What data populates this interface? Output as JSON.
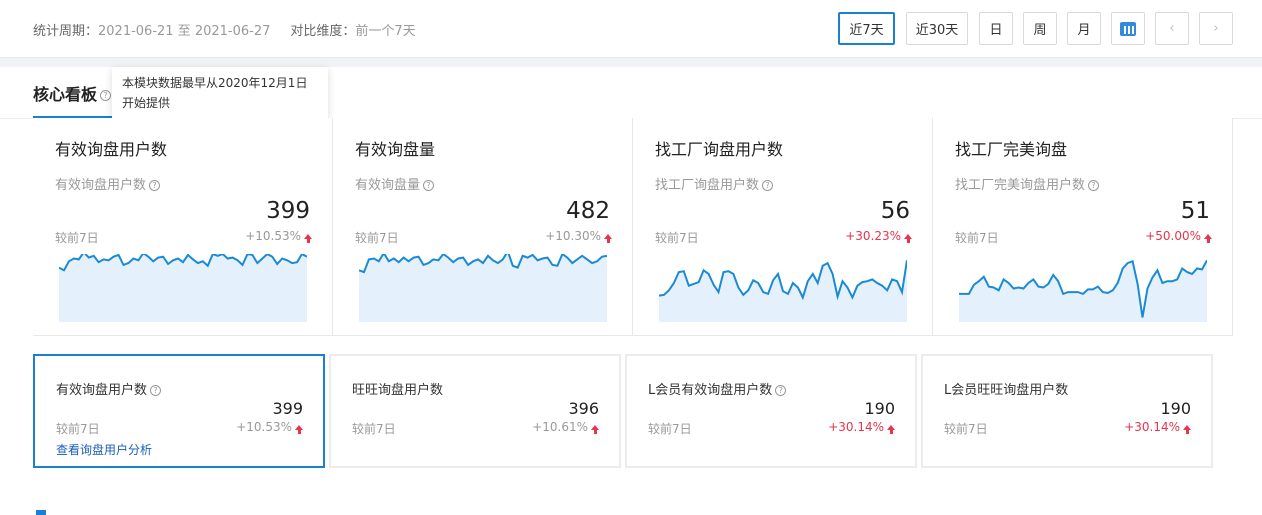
{
  "filter": {
    "period_label": "统计周期：",
    "period_value": "2021-06-21 至 2021-06-27",
    "compare_label": "对比维度：",
    "compare_value": "前一个7天",
    "buttons": [
      "近7天",
      "近30天",
      "日",
      "周",
      "月"
    ],
    "active_button": "近7天"
  },
  "board": {
    "tab_title": "核心看板",
    "help_glyph": "?",
    "tooltip": "本模块数据最早从2020年12月1日开始提供"
  },
  "big_cards": [
    {
      "title": "有效询盘用户数",
      "sub": "有效询盘用户数",
      "value": "399",
      "compare": "较前7日",
      "change": "+10.53%",
      "change_color": "gray",
      "series": [
        55,
        58,
        48,
        45,
        46,
        38,
        44,
        42,
        49,
        46,
        47,
        43,
        41,
        52,
        50,
        45,
        47,
        39,
        43,
        48,
        44,
        43,
        51,
        47,
        45,
        49,
        41,
        46,
        50,
        48,
        53,
        40,
        42,
        40,
        45,
        44,
        47,
        52,
        40,
        41,
        50,
        45,
        40,
        43,
        51,
        45,
        47,
        50,
        49,
        40,
        43
      ]
    },
    {
      "title": "有效询盘量",
      "sub": "有效询盘量",
      "value": "482",
      "compare": "较前7日",
      "change": "+10.30%",
      "change_color": "gray",
      "series": [
        58,
        60,
        46,
        45,
        48,
        39,
        48,
        45,
        49,
        44,
        48,
        44,
        43,
        52,
        50,
        46,
        47,
        40,
        44,
        49,
        45,
        44,
        52,
        48,
        46,
        50,
        42,
        47,
        50,
        46,
        37,
        53,
        55,
        42,
        44,
        41,
        47,
        45,
        44,
        52,
        53,
        40,
        44,
        50,
        46,
        42,
        46,
        50,
        48,
        43,
        42
      ]
    },
    {
      "title": "找工厂询盘用户数",
      "sub": "找工厂询盘用户数",
      "value": "56",
      "compare": "较前7日",
      "change": "+30.23%",
      "change_color": "red",
      "series": [
        86,
        85,
        80,
        72,
        60,
        59,
        75,
        73,
        71,
        58,
        62,
        74,
        82,
        60,
        59,
        62,
        77,
        85,
        80,
        69,
        72,
        82,
        84,
        69,
        62,
        81,
        84,
        72,
        77,
        88,
        70,
        62,
        72,
        53,
        50,
        62,
        87,
        70,
        77,
        88,
        75,
        71,
        70,
        68,
        72,
        75,
        80,
        68,
        70,
        82,
        47
      ]
    },
    {
      "title": "找工厂完美询盘",
      "sub": "找工厂完美询盘用户数",
      "value": "51",
      "compare": "较前7日",
      "change": "+50.00%",
      "change_color": "red",
      "series": [
        84,
        84,
        84,
        74,
        70,
        65,
        76,
        77,
        80,
        68,
        72,
        78,
        77,
        78,
        72,
        68,
        76,
        77,
        73,
        63,
        70,
        84,
        82,
        82,
        82,
        84,
        79,
        79,
        76,
        82,
        83,
        80,
        72,
        56,
        50,
        48,
        73,
        110,
        78,
        66,
        58,
        72,
        70,
        70,
        68,
        56,
        60,
        62,
        56,
        57,
        47
      ]
    }
  ],
  "small_cards": [
    {
      "title": "有效询盘用户数",
      "has_help": true,
      "value": "399",
      "compare": "较前7日",
      "change": "+10.53%",
      "change_color": "gray",
      "link": "查看询盘用户分析",
      "selected": true
    },
    {
      "title": "旺旺询盘用户数",
      "has_help": false,
      "value": "396",
      "compare": "较前7日",
      "change": "+10.61%",
      "change_color": "gray",
      "link": "",
      "selected": false
    },
    {
      "title": "L会员有效询盘用户数",
      "has_help": true,
      "value": "190",
      "compare": "较前7日",
      "change": "+30.14%",
      "change_color": "red",
      "link": "",
      "selected": false
    },
    {
      "title": "L会员旺旺询盘用户数",
      "has_help": false,
      "value": "190",
      "compare": "较前7日",
      "change": "+30.14%",
      "change_color": "red",
      "link": "",
      "selected": false
    }
  ],
  "colors": {
    "accent": "#1b7fd6",
    "up": "#e8344e",
    "area_fill": "#e4f1fc",
    "line": "#1b8ad4"
  }
}
